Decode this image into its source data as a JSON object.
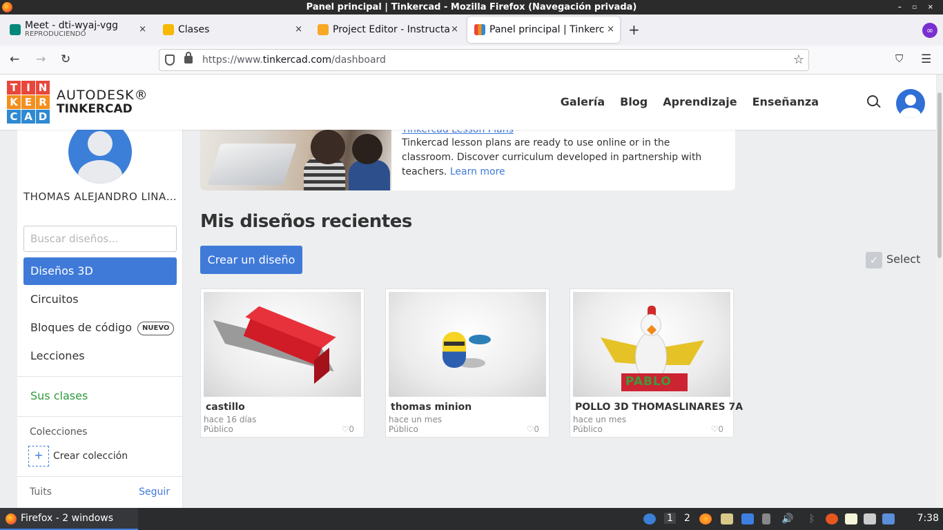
{
  "window": {
    "title": "Panel principal | Tinkercad - Mozilla Firefox (Navegación privada)",
    "controls": "– ▫ ×"
  },
  "tabs": [
    {
      "label": "Meet - dti-wyaj-vgg",
      "sublabel": "REPRODUCIENDO",
      "active": false,
      "icon_color": "#00897b"
    },
    {
      "label": "Clases",
      "active": false,
      "icon_color": "#f6b800"
    },
    {
      "label": "Project Editor - Instructables",
      "active": false,
      "icon_color": "#f9a825"
    },
    {
      "label": "Panel principal | Tinkercad",
      "active": true,
      "icon_color": "#e8473b"
    }
  ],
  "newtab": "+",
  "close": "×",
  "nav": {
    "back": "←",
    "forward": "→",
    "reload": "↻",
    "url_prefix": "https://www.",
    "url_host": "tinkercad.com",
    "url_path": "/dashboard",
    "bookmark": "☆",
    "pocket": "⛉",
    "menu": "☰"
  },
  "header": {
    "logo_letters": [
      "T",
      "I",
      "N",
      "K",
      "E",
      "R",
      "C",
      "A",
      "D"
    ],
    "logo_colors": [
      "#e8473b",
      "#e8473b",
      "#e8473b",
      "#f48f1e",
      "#f48f1e",
      "#f48f1e",
      "#2f8ad1",
      "#2f8ad1",
      "#2f8ad1"
    ],
    "brand_top": "AUTODESK®",
    "brand_bottom": "TINKERCAD",
    "nav_items": [
      "Galería",
      "Blog",
      "Aprendizaje",
      "Enseñanza"
    ]
  },
  "sidebar": {
    "user_name": "THOMAS ALEJANDRO LINARES",
    "search_placeholder": "Buscar diseños...",
    "items": [
      {
        "label": "Diseños 3D",
        "active": true
      },
      {
        "label": "Circuitos"
      },
      {
        "label": "Bloques de código",
        "badge": "NUEVO"
      },
      {
        "label": "Lecciones"
      }
    ],
    "classes": "Sus clases",
    "collections": "Colecciones",
    "new_collection": "Crear colección",
    "new_collection_plus": "+",
    "tweets": "Tuits",
    "follow": "Seguir"
  },
  "lesson": {
    "title": "Tinkercad Lesson Plans",
    "text": "Tinkercad lesson plans are ready to use online or in the classroom. Discover curriculum developed in partnership with teachers.",
    "link": "Learn more"
  },
  "main": {
    "heading": "Mis diseños recientes",
    "create_button": "Crear un diseño",
    "select_label": "Select",
    "select_check": "✓",
    "designs": [
      {
        "name": "castillo",
        "time": "hace 16 días",
        "visibility": "Público",
        "likes": "♡0"
      },
      {
        "name": "thomas minion",
        "time": "hace un mes",
        "visibility": "Público",
        "likes": "♡0"
      },
      {
        "name": "POLLO 3D THOMASLINARES 7A",
        "time": "hace un mes",
        "visibility": "Público",
        "likes": "♡0",
        "base_text": "PABLO"
      }
    ]
  },
  "taskbar": {
    "app": "Firefox - 2 windows",
    "ws1": "1",
    "ws2": "2",
    "clock": "7:38"
  }
}
